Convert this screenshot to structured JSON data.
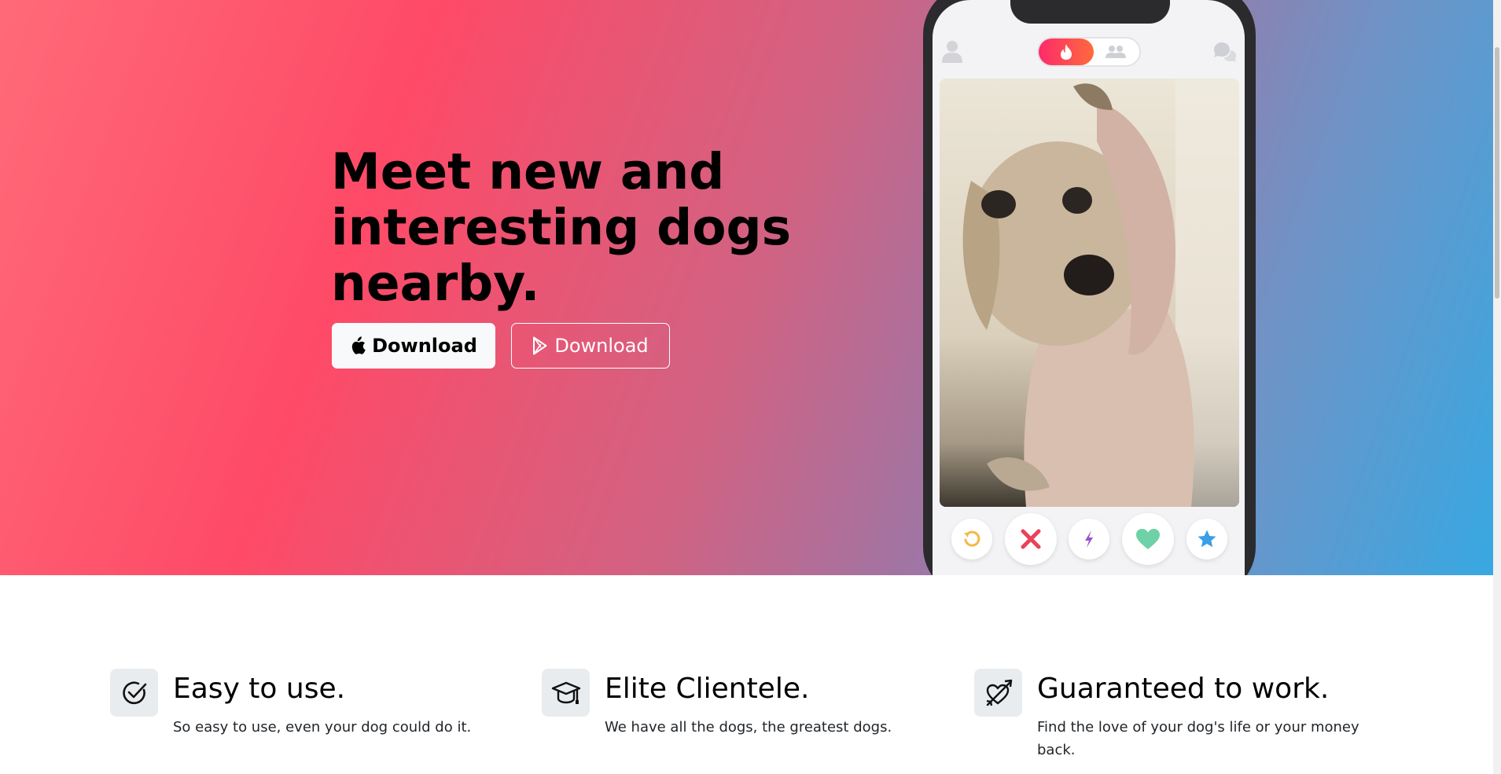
{
  "hero": {
    "headline": "Meet new and interesting dogs nearby.",
    "apple_button_label": "Download",
    "play_button_label": "Download"
  },
  "app_preview": {
    "profile_icon": "person-icon",
    "toggle_active_icon": "flame-icon",
    "toggle_inactive_icon": "group-icon",
    "chat_icon": "chat-bubbles-icon",
    "photo": "dog-photo",
    "actions": [
      "rewind-icon",
      "nope-icon",
      "boost-icon",
      "like-icon",
      "super-like-icon"
    ],
    "colors": {
      "toggle": "#fd2a6b",
      "rewind": "#f5b748",
      "nope": "#e94259",
      "boost": "#9b53c9",
      "like": "#6fd1a8",
      "super_like": "#3a9fe6"
    }
  },
  "features": [
    {
      "icon": "check-circle-icon",
      "title": "Easy to use.",
      "description": "So easy to use, even your dog could do it."
    },
    {
      "icon": "graduation-cap-icon",
      "title": "Elite Clientele.",
      "description": "We have all the dogs, the greatest dogs."
    },
    {
      "icon": "arrow-heart-icon",
      "title": "Guaranteed to work.",
      "description": "Find the love of your dog's life or your money back."
    }
  ]
}
